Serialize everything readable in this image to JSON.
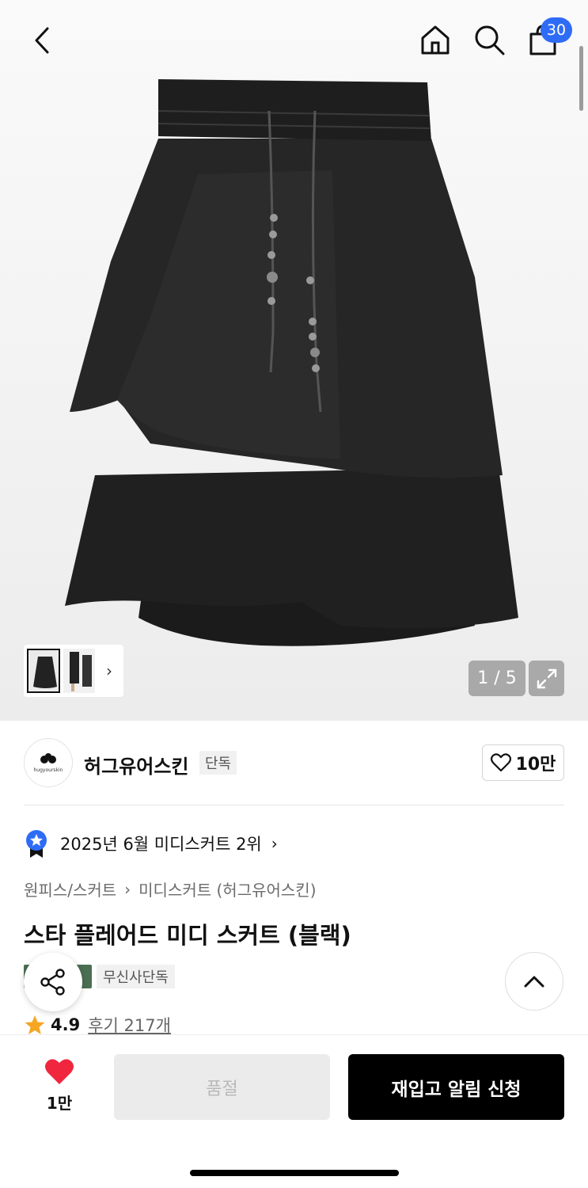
{
  "header": {
    "back_icon": "chevron-left-icon",
    "home_icon": "home-icon",
    "search_icon": "search-icon",
    "cart_icon": "shopping-bag-icon",
    "cart_count": "30"
  },
  "gallery": {
    "counter": "1 / 5",
    "expand_icon": "expand-icon",
    "thumbnail_next_icon": "chevron-right-icon"
  },
  "brand": {
    "name": "허그유어스킨",
    "logo_text": "hugyourskin",
    "exclusive_tag": "단독",
    "like_count": "10만"
  },
  "ranking": {
    "text": "2025년 6월 미디스커트 2위"
  },
  "breadcrumb": {
    "category": "원피스/스커트",
    "subcategory": "미디스커트 (허그유어스킨)"
  },
  "product": {
    "title": "스타 플레어드 미디 스커트 (블랙)",
    "tag_exclusive": "무신사단독",
    "rating": "4.9",
    "reviews": "후기 217개"
  },
  "bottom": {
    "fav_count": "1만",
    "soldout_label": "품절",
    "restock_label": "재입고 알림 신청"
  },
  "colors": {
    "accent_blue": "#2f6cf6",
    "heart_red": "#f0263e",
    "tag_green": "#4b6f52"
  }
}
